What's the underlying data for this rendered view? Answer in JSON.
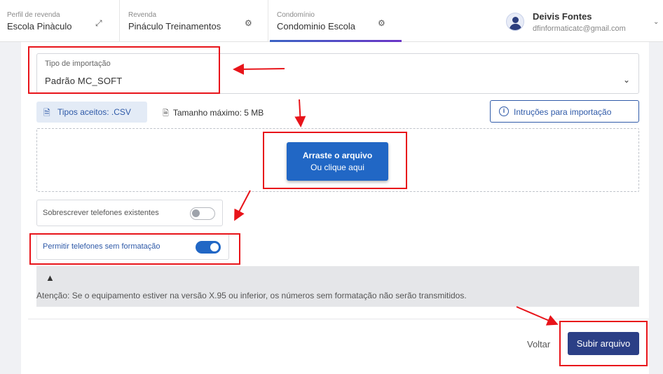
{
  "header": {
    "segments": [
      {
        "label": "Perfil de revenda",
        "value": "Escola Pinàculo",
        "icon": "swap-arrows-icon"
      },
      {
        "label": "Revenda",
        "value": "Pináculo Treinamentos",
        "icon": "gear-icon"
      },
      {
        "label": "Condomínio",
        "value": "Condominio Escola",
        "icon": "gear-icon"
      }
    ],
    "user": {
      "name": "Deivis Fontes",
      "email": "dfinformaticatc@gmail.com"
    }
  },
  "form": {
    "import_type_label": "Tipo de importação",
    "import_type_value": "Padrão MC_SOFT",
    "accepted_types": "Tipos aceitos: .CSV",
    "max_size": "Tamanho máximo: 5 MB",
    "instructions_button": "Intruções para importação",
    "upload_title": "Arraste o arquivo",
    "upload_subtitle": "Ou clique aqui",
    "overwrite_label": "Sobrescrever telefones existentes",
    "overwrite_on": false,
    "unformatted_label": "Permitir telefones sem formatação",
    "unformatted_on": true,
    "warning_text": "Atenção: Se o equipamento estiver na versão X.95 ou inferior, os números sem formatação não serão transmitidos.",
    "back_label": "Voltar",
    "submit_label": "Subir arquivo"
  },
  "colors": {
    "accent": "#2167c5",
    "submit": "#2b3f86",
    "annotation": "#e8141a"
  }
}
